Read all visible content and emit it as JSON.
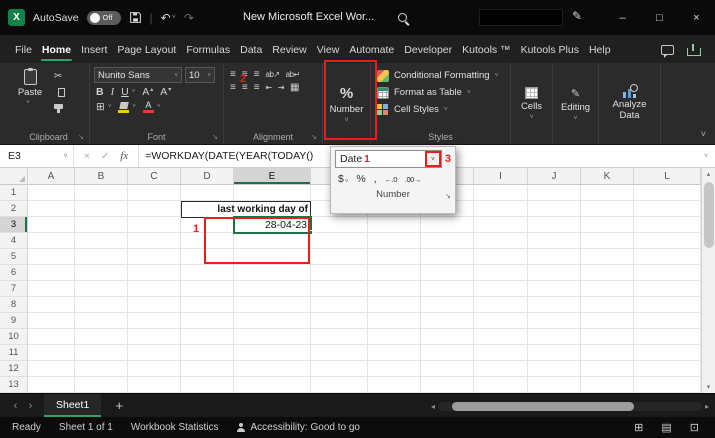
{
  "colors": {
    "accent_green": "#1e7145",
    "annotation_red": "#ec1c1c",
    "fill_color_bar": "#f2c811",
    "font_color_bar": "#e03c31"
  },
  "icons": {
    "app_glyph": "X",
    "chevron_down": "˅",
    "select_all": "◢",
    "undo": "↶",
    "redo": "↷",
    "minimize": "–",
    "maximize": "□",
    "close": "×",
    "ink_pen": "✎",
    "separator": "|",
    "cut": "✂",
    "bold": "B",
    "italic": "I",
    "underline": "U",
    "letter_a": "A",
    "sup_up": "▴",
    "sup_down": "▾",
    "borders": "⊞",
    "align_lines": "≡",
    "orientation": "ab↗",
    "wrap": "ab↵",
    "indent_dec": "⇤",
    "indent_inc": "⇥",
    "merge": "▦",
    "percent": "%",
    "dollar": "$",
    "comma": ",",
    "inc_decimal": "←.0",
    "dec_decimal": ".00→",
    "cancel": "×",
    "enter": "✓",
    "fx": "fx",
    "expand": "˅",
    "prev": "‹",
    "next": "›",
    "add": "+",
    "hleft": "◂",
    "hright": "▸",
    "vup": "▴",
    "vdown": "▾",
    "view_normal": "⊞",
    "view_layout": "▤",
    "view_break": "⊡",
    "launcher": "↘"
  },
  "titlebar": {
    "autosave_label": "AutoSave",
    "autosave_state": "Off",
    "title": "New Microsoft Excel Wor..."
  },
  "menubar": {
    "tabs": [
      {
        "label": "File",
        "active": false
      },
      {
        "label": "Home",
        "active": true
      },
      {
        "label": "Insert",
        "active": false
      },
      {
        "label": "Page Layout",
        "active": false
      },
      {
        "label": "Formulas",
        "active": false
      },
      {
        "label": "Data",
        "active": false
      },
      {
        "label": "Review",
        "active": false
      },
      {
        "label": "View",
        "active": false
      },
      {
        "label": "Automate",
        "active": false
      },
      {
        "label": "Developer",
        "active": false
      },
      {
        "label": "Kutools ™",
        "active": false
      },
      {
        "label": "Kutools Plus",
        "active": false
      },
      {
        "label": "Help",
        "active": false
      }
    ]
  },
  "ribbon": {
    "paste_label": "Paste",
    "clipboard_label": "Clipboard",
    "font_name": "Nunito Sans",
    "font_size": "10",
    "font_label": "Font",
    "alignment_label": "Alignment",
    "number_button_label": "Number",
    "styles": {
      "items": [
        "Conditional Formatting",
        "Format as Table",
        "Cell Styles"
      ],
      "label": "Styles"
    },
    "cells_label": "Cells",
    "editing_label": "Editing",
    "analyze_label": "Analyze Data"
  },
  "formula_bar": {
    "name_box": "E3",
    "formula": "=WORKDAY(DATE(YEAR(TODAY()"
  },
  "number_flyout": {
    "format_name": "Date",
    "group_label": "Number"
  },
  "grid": {
    "columns": [
      "A",
      "B",
      "C",
      "D",
      "E",
      "F",
      "G",
      "H",
      "I",
      "J",
      "K",
      "L"
    ],
    "rows": [
      "1",
      "2",
      "3",
      "4",
      "5",
      "6",
      "7",
      "8",
      "9",
      "10",
      "11",
      "12",
      "13"
    ],
    "caption": "last working day of",
    "selected_cell": "E3",
    "selected_value": "28-04-23",
    "selected_column": "E",
    "selected_row": "3"
  },
  "annotations": {
    "one": "1",
    "two": "2",
    "three": "3",
    "combo_mark": "1"
  },
  "sheetbar": {
    "sheet": "Sheet1"
  },
  "statusbar": {
    "ready": "Ready",
    "sheets": "Sheet 1 of 1",
    "stats": "Workbook Statistics",
    "accessibility": "Accessibility: Good to go"
  }
}
